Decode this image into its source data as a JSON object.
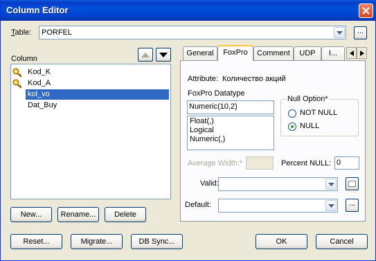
{
  "window": {
    "title": "Column Editor"
  },
  "table": {
    "label": "Table:",
    "label_accel": "T",
    "label_rest": "able:",
    "value": "PORFEL",
    "browse_label": "..."
  },
  "columns": {
    "label": "Column",
    "items": [
      {
        "name": "Kod_K",
        "key": true,
        "selected": false
      },
      {
        "name": "Kod_A",
        "key": true,
        "selected": false
      },
      {
        "name": "kol_vo",
        "key": false,
        "selected": true
      },
      {
        "name": "Dat_Buy",
        "key": false,
        "selected": false
      }
    ]
  },
  "column_buttons": {
    "new_label": "New...",
    "rename_label": "Rename...",
    "delete_label": "Delete"
  },
  "tabs": [
    {
      "label": "General",
      "active": false
    },
    {
      "label": "FoxPro",
      "active": true
    },
    {
      "label": "Comment",
      "active": false
    },
    {
      "label": "UDP",
      "active": false
    },
    {
      "label": "I...",
      "active": false
    }
  ],
  "foxpro": {
    "attribute_label": "Attribute:",
    "attribute_value": "Количество акций",
    "datatype_label": "FoxPro Datatype",
    "datatype_value": "Numeric(10,2)",
    "datatype_options": [
      "Float(,)",
      "Logical",
      "Numeric(,)"
    ],
    "null_option_label": "Null Option*",
    "not_null_label": "NOT NULL",
    "null_label": "NULL",
    "null_selected": "NULL",
    "average_width_label": "Average Width:*",
    "average_width_value": "",
    "percent_null_label": "Percent NULL:",
    "percent_null_value": "0",
    "valid_label": "Valid:",
    "valid_value": "",
    "default_label": "Default:",
    "default_value": "",
    "default_browse_label": "..."
  },
  "footer": {
    "reset_label": "Reset...",
    "migrate_label": "Migrate...",
    "dbsync_label": "DB Sync...",
    "ok_label": "OK",
    "cancel_label": "Cancel"
  },
  "colors": {
    "titlebar": "#0050d8",
    "selection": "#316ac5",
    "active_tab_accent": "#ffc83c"
  }
}
